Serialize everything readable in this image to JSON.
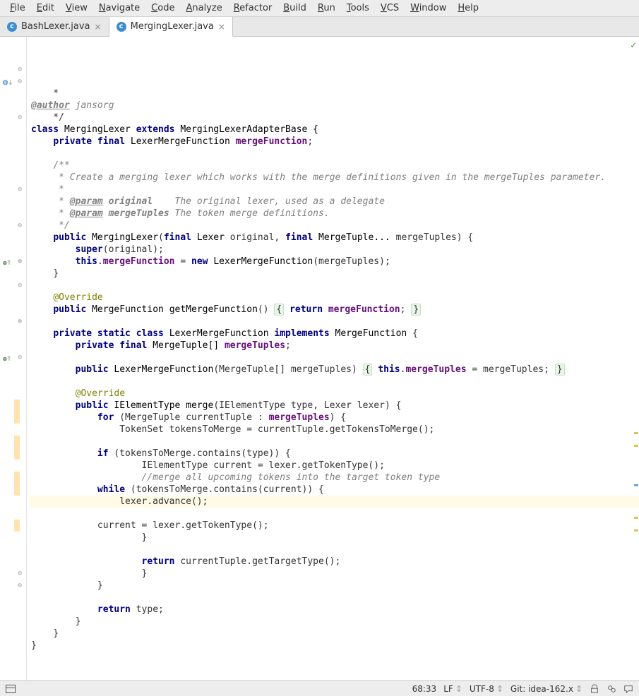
{
  "menu": [
    "File",
    "Edit",
    "View",
    "Navigate",
    "Code",
    "Analyze",
    "Refactor",
    "Build",
    "Run",
    "Tools",
    "VCS",
    "Window",
    "Help"
  ],
  "tabs": [
    {
      "icon": "c",
      "label": "BashLexer.java",
      "active": false
    },
    {
      "icon": "c",
      "label": "MergingLexer.java",
      "active": true
    }
  ],
  "code": {
    "lines": [
      {
        "t": "    *"
      },
      {
        "t": "    * ",
        "spans": [
          {
            "c": "doctag",
            "t": "@author"
          },
          {
            "c": "docauthor",
            "t": " jansorg"
          }
        ]
      },
      {
        "t": "    */"
      },
      {
        "spans": [
          {
            "c": "kw",
            "t": "class "
          },
          {
            "c": "type",
            "t": "MergingLexer "
          },
          {
            "c": "kw",
            "t": "extends "
          },
          {
            "c": "type",
            "t": "MergingLexerAdapterBase {"
          }
        ]
      },
      {
        "spans": [
          {
            "t": "    "
          },
          {
            "c": "kw",
            "t": "private final "
          },
          {
            "c": "type",
            "t": "LexerMergeFunction "
          },
          {
            "c": "field",
            "t": "mergeFunction"
          },
          {
            "t": ";"
          }
        ]
      },
      {
        "t": ""
      },
      {
        "spans": [
          {
            "t": "    "
          },
          {
            "c": "cmt",
            "t": "/**"
          }
        ]
      },
      {
        "spans": [
          {
            "t": "     "
          },
          {
            "c": "cmt",
            "t": "* Create a merging lexer which works with the merge definitions given in the mergeTuples parameter."
          }
        ]
      },
      {
        "spans": [
          {
            "t": "     "
          },
          {
            "c": "cmt",
            "t": "*"
          }
        ]
      },
      {
        "spans": [
          {
            "t": "     "
          },
          {
            "c": "cmt",
            "t": "* "
          },
          {
            "c": "doctag",
            "t": "@param"
          },
          {
            "c": "cmt",
            "t": " "
          },
          {
            "c": "cmt b",
            "t": "original"
          },
          {
            "c": "cmt",
            "t": "    The original lexer, used as a delegate"
          }
        ]
      },
      {
        "spans": [
          {
            "t": "     "
          },
          {
            "c": "cmt",
            "t": "* "
          },
          {
            "c": "doctag",
            "t": "@param"
          },
          {
            "c": "cmt",
            "t": " "
          },
          {
            "c": "cmt b",
            "t": "mergeTuples"
          },
          {
            "c": "cmt",
            "t": " The token merge definitions."
          }
        ]
      },
      {
        "spans": [
          {
            "t": "     "
          },
          {
            "c": "cmt",
            "t": "*/"
          }
        ]
      },
      {
        "spans": [
          {
            "t": "    "
          },
          {
            "c": "kw",
            "t": "public "
          },
          {
            "c": "method",
            "t": "MergingLexer"
          },
          {
            "t": "("
          },
          {
            "c": "kw",
            "t": "final "
          },
          {
            "c": "type",
            "t": "Lexer "
          },
          {
            "t": "original, "
          },
          {
            "c": "kw",
            "t": "final "
          },
          {
            "c": "type",
            "t": "MergeTuple... "
          },
          {
            "t": "mergeTuples) {"
          }
        ]
      },
      {
        "spans": [
          {
            "t": "        "
          },
          {
            "c": "kw",
            "t": "super"
          },
          {
            "t": "(original);"
          }
        ]
      },
      {
        "spans": [
          {
            "t": "        "
          },
          {
            "c": "kw",
            "t": "this"
          },
          {
            "t": "."
          },
          {
            "c": "field",
            "t": "mergeFunction"
          },
          {
            "t": " = "
          },
          {
            "c": "kw",
            "t": "new "
          },
          {
            "c": "type",
            "t": "LexerMergeFunction"
          },
          {
            "t": "(mergeTuples);"
          }
        ]
      },
      {
        "t": "    }"
      },
      {
        "t": ""
      },
      {
        "spans": [
          {
            "t": "    "
          },
          {
            "c": "ann",
            "t": "@Override"
          }
        ]
      },
      {
        "spans": [
          {
            "t": "    "
          },
          {
            "c": "kw",
            "t": "public "
          },
          {
            "c": "type",
            "t": "MergeFunction "
          },
          {
            "c": "method",
            "t": "getMergeFunction"
          },
          {
            "t": "() "
          },
          {
            "c": "collapse-brace",
            "t": "{"
          },
          {
            "t": " "
          },
          {
            "c": "kw",
            "t": "return "
          },
          {
            "c": "field",
            "t": "mergeFunction"
          },
          {
            "t": "; "
          },
          {
            "c": "collapse-brace",
            "t": "}"
          }
        ]
      },
      {
        "t": ""
      },
      {
        "spans": [
          {
            "t": "    "
          },
          {
            "c": "kw",
            "t": "private static class "
          },
          {
            "c": "type",
            "t": "LexerMergeFunction "
          },
          {
            "c": "kw",
            "t": "implements "
          },
          {
            "c": "type",
            "t": "MergeFunction "
          },
          {
            "t": "{"
          }
        ]
      },
      {
        "spans": [
          {
            "t": "        "
          },
          {
            "c": "kw",
            "t": "private final "
          },
          {
            "c": "type",
            "t": "MergeTuple[] "
          },
          {
            "c": "field",
            "t": "mergeTuples"
          },
          {
            "t": ";"
          }
        ]
      },
      {
        "t": ""
      },
      {
        "spans": [
          {
            "t": "        "
          },
          {
            "c": "kw",
            "t": "public "
          },
          {
            "c": "method",
            "t": "LexerMergeFunction"
          },
          {
            "t": "(MergeTuple[] mergeTuples) "
          },
          {
            "c": "collapse-brace",
            "t": "{"
          },
          {
            "t": " "
          },
          {
            "c": "kw",
            "t": "this"
          },
          {
            "t": "."
          },
          {
            "c": "field",
            "t": "mergeTuples"
          },
          {
            "t": " = mergeTuples; "
          },
          {
            "c": "collapse-brace",
            "t": "}"
          }
        ]
      },
      {
        "t": ""
      },
      {
        "spans": [
          {
            "t": "        "
          },
          {
            "c": "ann",
            "t": "@Override"
          }
        ]
      },
      {
        "spans": [
          {
            "t": "        "
          },
          {
            "c": "kw",
            "t": "public "
          },
          {
            "c": "type",
            "t": "IElementType "
          },
          {
            "c": "method",
            "t": "merge"
          },
          {
            "t": "(IElementType type, Lexer lexer) {"
          }
        ]
      },
      {
        "spans": [
          {
            "t": "            "
          },
          {
            "c": "kw",
            "t": "for "
          },
          {
            "t": "(MergeTuple currentTuple : "
          },
          {
            "c": "field",
            "t": "mergeTuples"
          },
          {
            "t": ") {"
          }
        ]
      },
      {
        "spans": [
          {
            "t": "                TokenSet tokensToMerge = currentTuple.getTokensToMerge();"
          }
        ]
      },
      {
        "t": ""
      },
      {
        "chg": true,
        "spans": [
          {
            "t": "            "
          },
          {
            "c": "kw",
            "t": "if "
          },
          {
            "t": "(tokensToMerge.contains(type)) {"
          }
        ]
      },
      {
        "chg": true,
        "spans": [
          {
            "t": "                    IElementType current = lexer.getTokenType();"
          }
        ]
      },
      {
        "spans": [
          {
            "t": "                    "
          },
          {
            "c": "cmt",
            "t": "//merge all upcoming tokens into the target token type"
          }
        ]
      },
      {
        "chg": true,
        "spans": [
          {
            "t": "            "
          },
          {
            "c": "kw",
            "t": "while "
          },
          {
            "t": "(tokensToMerge.contains(current)) {"
          }
        ]
      },
      {
        "hl": true,
        "chg": true,
        "spans": [
          {
            "t": "                lexer.advance();"
          }
        ]
      },
      {
        "t": ""
      },
      {
        "chg": true,
        "spans": [
          {
            "t": "            current = lexer.getTokenType();"
          }
        ]
      },
      {
        "chg": true,
        "t": "                    }"
      },
      {
        "t": ""
      },
      {
        "spans": [
          {
            "t": "                    "
          },
          {
            "c": "kw",
            "t": "return "
          },
          {
            "t": "currentTuple.getTargetType();"
          }
        ]
      },
      {
        "chg": true,
        "t": "                    }"
      },
      {
        "t": "            }"
      },
      {
        "t": ""
      },
      {
        "spans": [
          {
            "t": "            "
          },
          {
            "c": "kw",
            "t": "return "
          },
          {
            "t": "type;"
          }
        ]
      },
      {
        "t": "        }"
      },
      {
        "t": "    }"
      },
      {
        "t": "}"
      }
    ]
  },
  "status": {
    "pos": "68:33",
    "lineSep": "LF",
    "enc": "UTF-8",
    "git": "Git: idea-162.x",
    "iconsRight": [
      "lock-icon",
      "notifications-icon",
      "chat-icon"
    ]
  }
}
